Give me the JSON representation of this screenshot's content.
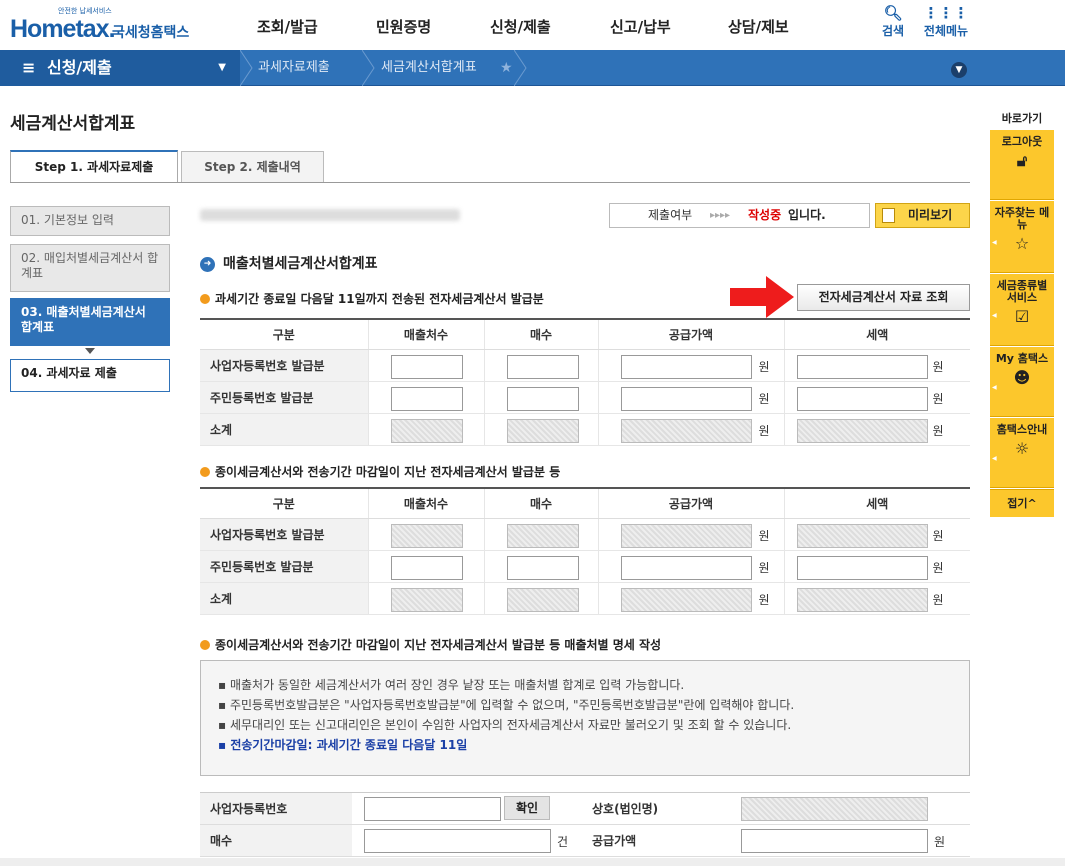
{
  "logo": {
    "tagline": "안전한 납세서비스",
    "main": "Hometax.",
    "korean": "국세청홈택스"
  },
  "gnav": [
    "조회/발급",
    "민원증명",
    "신청/제출",
    "신고/납부",
    "상담/제보"
  ],
  "util": {
    "search": "검색",
    "menu": "전체메뉴"
  },
  "navbar": {
    "main": "신청/제출",
    "crumb1": "과세자료제출",
    "crumb2": "세금계산서합계표"
  },
  "page_title": "세금계산서합계표",
  "tabs": [
    "Step 1. 과세자료제출",
    "Step 2. 제출내역"
  ],
  "steps": [
    "01. 기본정보 입력",
    "02. 매입처별세금계산서 합계표",
    "03. 매출처별세금계산서 합계표",
    "04. 과세자료 제출"
  ],
  "status": {
    "label": "제출여부",
    "arrows": "▸▸▸▸",
    "state": "작성중",
    "suffix": "입니다.",
    "preview": "미리보기"
  },
  "section_title": "매출처별세금계산서합계표",
  "sub1": "과세기간 종료일 다음달 11일까지 전송된 전자세금계산서 발급분",
  "sub2": "종이세금계산서와 전송기간 마감일이 지난 전자세금계산서 발급분 등",
  "sub3": "종이세금계산서와 전송기간 마감일이 지난 전자세금계산서 발급분 등 매출처별 명세 작성",
  "lookup_button": "전자세금계산서 자료 조회",
  "table": {
    "headers": [
      "구분",
      "매출처수",
      "매수",
      "공급가액",
      "세액"
    ],
    "rows": [
      "사업자등록번호 발급분",
      "주민등록번호 발급분",
      "소계"
    ],
    "unit": "원"
  },
  "notes": [
    "매출처가 동일한 세금계산서가 여러 장인 경우 낱장 또는 매출처별 합계로 입력 가능합니다.",
    "주민등록번호발급분은 \"사업자등록번호발급분\"에 입력할 수 없으며, \"주민등록번호발급분\"란에 입력해야 합니다.",
    "세무대리인 또는 신고대리인은 본인이 수임한 사업자의 전자세금계산서 자료만 불러오기 및 조회 할 수 있습니다.",
    "전송기간마감일: 과세기간 종료일 다음달 11일"
  ],
  "form": {
    "biz_no": "사업자등록번호",
    "confirm": "확인",
    "company": "상호(법인명)",
    "count": "매수",
    "count_unit": "건",
    "supply": "공급가액",
    "supply_unit": "원"
  },
  "quick": {
    "title": "바로가기",
    "items": [
      "로그아웃",
      "자주찾는 메뉴",
      "세금종류별 서비스",
      "My 홈택스",
      "홈택스안내"
    ],
    "close": "접기^"
  }
}
